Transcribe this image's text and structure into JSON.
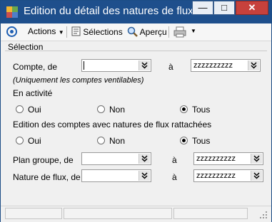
{
  "window": {
    "title": "Edition du détail des natures de flux"
  },
  "title_controls": {
    "minimize": "—",
    "maximize": "□",
    "close": "✕"
  },
  "toolbar": {
    "actions": "Actions",
    "selections": "Sélections",
    "apercu": "Aperçu"
  },
  "form": {
    "section": "Sélection",
    "compte_label": "Compte, de",
    "a_label": "à",
    "compte_from": "",
    "compte_to": "zzzzzzzzzz",
    "hint": "(Uniquement les comptes ventilables)",
    "en_activite": "En activité",
    "oui": "Oui",
    "non": "Non",
    "tous": "Tous",
    "edition_label": "Edition des comptes avec natures de flux rattachées",
    "plan_label": "Plan groupe, de",
    "plan_from": "",
    "plan_to": "zzzzzzzzzz",
    "nature_label": "Nature de flux, de",
    "nature_from": "",
    "nature_to": "zzzzzzzzzz"
  },
  "colors": {
    "titlebar": "#1e4f8c",
    "close": "#c7413c"
  }
}
